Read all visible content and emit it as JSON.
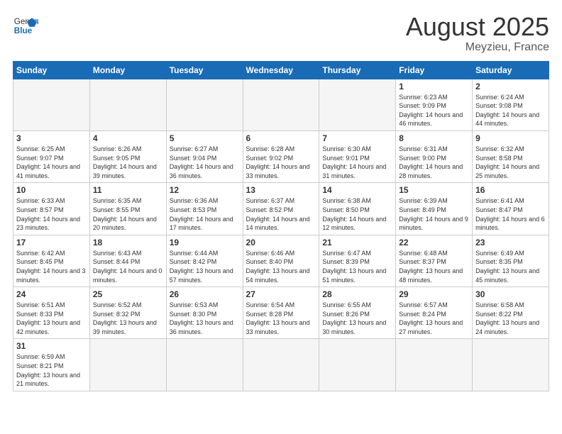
{
  "header": {
    "logo_general": "General",
    "logo_blue": "Blue",
    "month_title": "August 2025",
    "location": "Meyzieu, France"
  },
  "weekdays": [
    "Sunday",
    "Monday",
    "Tuesday",
    "Wednesday",
    "Thursday",
    "Friday",
    "Saturday"
  ],
  "weeks": [
    [
      {
        "day": "",
        "info": ""
      },
      {
        "day": "",
        "info": ""
      },
      {
        "day": "",
        "info": ""
      },
      {
        "day": "",
        "info": ""
      },
      {
        "day": "",
        "info": ""
      },
      {
        "day": "1",
        "info": "Sunrise: 6:23 AM\nSunset: 9:09 PM\nDaylight: 14 hours and 46 minutes."
      },
      {
        "day": "2",
        "info": "Sunrise: 6:24 AM\nSunset: 9:08 PM\nDaylight: 14 hours and 44 minutes."
      }
    ],
    [
      {
        "day": "3",
        "info": "Sunrise: 6:25 AM\nSunset: 9:07 PM\nDaylight: 14 hours and 41 minutes."
      },
      {
        "day": "4",
        "info": "Sunrise: 6:26 AM\nSunset: 9:05 PM\nDaylight: 14 hours and 39 minutes."
      },
      {
        "day": "5",
        "info": "Sunrise: 6:27 AM\nSunset: 9:04 PM\nDaylight: 14 hours and 36 minutes."
      },
      {
        "day": "6",
        "info": "Sunrise: 6:28 AM\nSunset: 9:02 PM\nDaylight: 14 hours and 33 minutes."
      },
      {
        "day": "7",
        "info": "Sunrise: 6:30 AM\nSunset: 9:01 PM\nDaylight: 14 hours and 31 minutes."
      },
      {
        "day": "8",
        "info": "Sunrise: 6:31 AM\nSunset: 9:00 PM\nDaylight: 14 hours and 28 minutes."
      },
      {
        "day": "9",
        "info": "Sunrise: 6:32 AM\nSunset: 8:58 PM\nDaylight: 14 hours and 25 minutes."
      }
    ],
    [
      {
        "day": "10",
        "info": "Sunrise: 6:33 AM\nSunset: 8:57 PM\nDaylight: 14 hours and 23 minutes."
      },
      {
        "day": "11",
        "info": "Sunrise: 6:35 AM\nSunset: 8:55 PM\nDaylight: 14 hours and 20 minutes."
      },
      {
        "day": "12",
        "info": "Sunrise: 6:36 AM\nSunset: 8:53 PM\nDaylight: 14 hours and 17 minutes."
      },
      {
        "day": "13",
        "info": "Sunrise: 6:37 AM\nSunset: 8:52 PM\nDaylight: 14 hours and 14 minutes."
      },
      {
        "day": "14",
        "info": "Sunrise: 6:38 AM\nSunset: 8:50 PM\nDaylight: 14 hours and 12 minutes."
      },
      {
        "day": "15",
        "info": "Sunrise: 6:39 AM\nSunset: 8:49 PM\nDaylight: 14 hours and 9 minutes."
      },
      {
        "day": "16",
        "info": "Sunrise: 6:41 AM\nSunset: 8:47 PM\nDaylight: 14 hours and 6 minutes."
      }
    ],
    [
      {
        "day": "17",
        "info": "Sunrise: 6:42 AM\nSunset: 8:45 PM\nDaylight: 14 hours and 3 minutes."
      },
      {
        "day": "18",
        "info": "Sunrise: 6:43 AM\nSunset: 8:44 PM\nDaylight: 14 hours and 0 minutes."
      },
      {
        "day": "19",
        "info": "Sunrise: 6:44 AM\nSunset: 8:42 PM\nDaylight: 13 hours and 57 minutes."
      },
      {
        "day": "20",
        "info": "Sunrise: 6:46 AM\nSunset: 8:40 PM\nDaylight: 13 hours and 54 minutes."
      },
      {
        "day": "21",
        "info": "Sunrise: 6:47 AM\nSunset: 8:39 PM\nDaylight: 13 hours and 51 minutes."
      },
      {
        "day": "22",
        "info": "Sunrise: 6:48 AM\nSunset: 8:37 PM\nDaylight: 13 hours and 48 minutes."
      },
      {
        "day": "23",
        "info": "Sunrise: 6:49 AM\nSunset: 8:35 PM\nDaylight: 13 hours and 45 minutes."
      }
    ],
    [
      {
        "day": "24",
        "info": "Sunrise: 6:51 AM\nSunset: 8:33 PM\nDaylight: 13 hours and 42 minutes."
      },
      {
        "day": "25",
        "info": "Sunrise: 6:52 AM\nSunset: 8:32 PM\nDaylight: 13 hours and 39 minutes."
      },
      {
        "day": "26",
        "info": "Sunrise: 6:53 AM\nSunset: 8:30 PM\nDaylight: 13 hours and 36 minutes."
      },
      {
        "day": "27",
        "info": "Sunrise: 6:54 AM\nSunset: 8:28 PM\nDaylight: 13 hours and 33 minutes."
      },
      {
        "day": "28",
        "info": "Sunrise: 6:55 AM\nSunset: 8:26 PM\nDaylight: 13 hours and 30 minutes."
      },
      {
        "day": "29",
        "info": "Sunrise: 6:57 AM\nSunset: 8:24 PM\nDaylight: 13 hours and 27 minutes."
      },
      {
        "day": "30",
        "info": "Sunrise: 6:58 AM\nSunset: 8:22 PM\nDaylight: 13 hours and 24 minutes."
      }
    ],
    [
      {
        "day": "31",
        "info": "Sunrise: 6:59 AM\nSunset: 8:21 PM\nDaylight: 13 hours and 21 minutes."
      },
      {
        "day": "",
        "info": ""
      },
      {
        "day": "",
        "info": ""
      },
      {
        "day": "",
        "info": ""
      },
      {
        "day": "",
        "info": ""
      },
      {
        "day": "",
        "info": ""
      },
      {
        "day": "",
        "info": ""
      }
    ]
  ]
}
